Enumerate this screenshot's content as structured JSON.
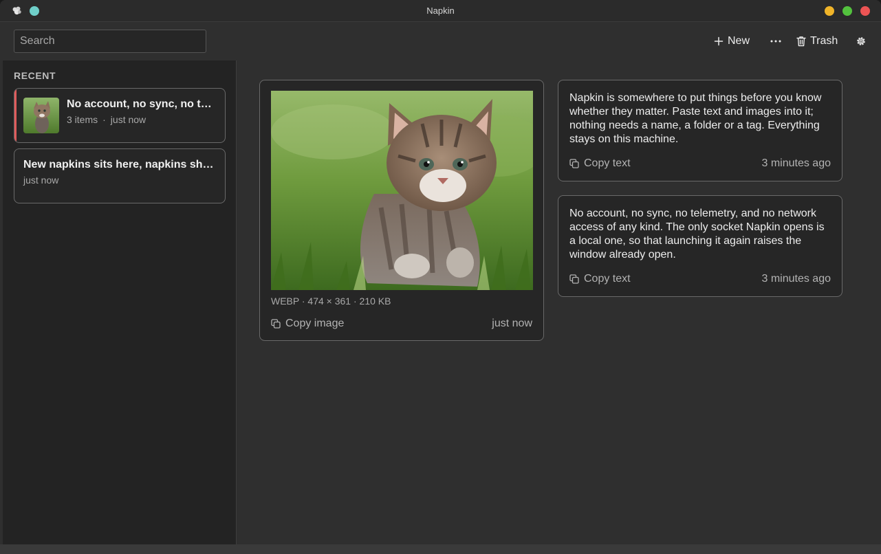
{
  "window": {
    "title": "Napkin"
  },
  "toolbar": {
    "search_placeholder": "Search",
    "new_label": "New",
    "trash_label": "Trash"
  },
  "sidebar": {
    "section_label": "RECENT",
    "items": [
      {
        "title": "No account, no sync, no telemetry, and no network access of any kind.",
        "count": "3 items",
        "separator": "·",
        "time": "just now",
        "active": true
      },
      {
        "title": "New napkins sits here, napkins show up in the sidebar",
        "time": "just now",
        "active": false
      }
    ]
  },
  "main": {
    "image_card": {
      "meta": "WEBP · 474 × 361 · 210 KB",
      "copy_label": "Copy image",
      "time": "just now"
    },
    "text_cards": [
      {
        "text": "Napkin is somewhere to put things before you know whether they matter. Paste text and images into it; nothing needs a name, a folder or a tag. Everything stays on this machine.",
        "copy_label": "Copy text",
        "time": "3 minutes ago"
      },
      {
        "text": "No account, no sync, no telemetry, and no network access of any kind. The only socket Napkin opens is a local one, so that launching it again raises the window already open.",
        "copy_label": "Copy text",
        "time": "3 minutes ago"
      }
    ]
  },
  "colors": {
    "accent_active": "#e05b5b",
    "teal_status": "#6fcfc9",
    "min": "#f0b429",
    "max": "#53c23e",
    "close": "#ec5454"
  },
  "icons": [
    "app-icon",
    "plus-icon",
    "more-icon",
    "trash-icon",
    "gear-icon",
    "copy-icon"
  ]
}
